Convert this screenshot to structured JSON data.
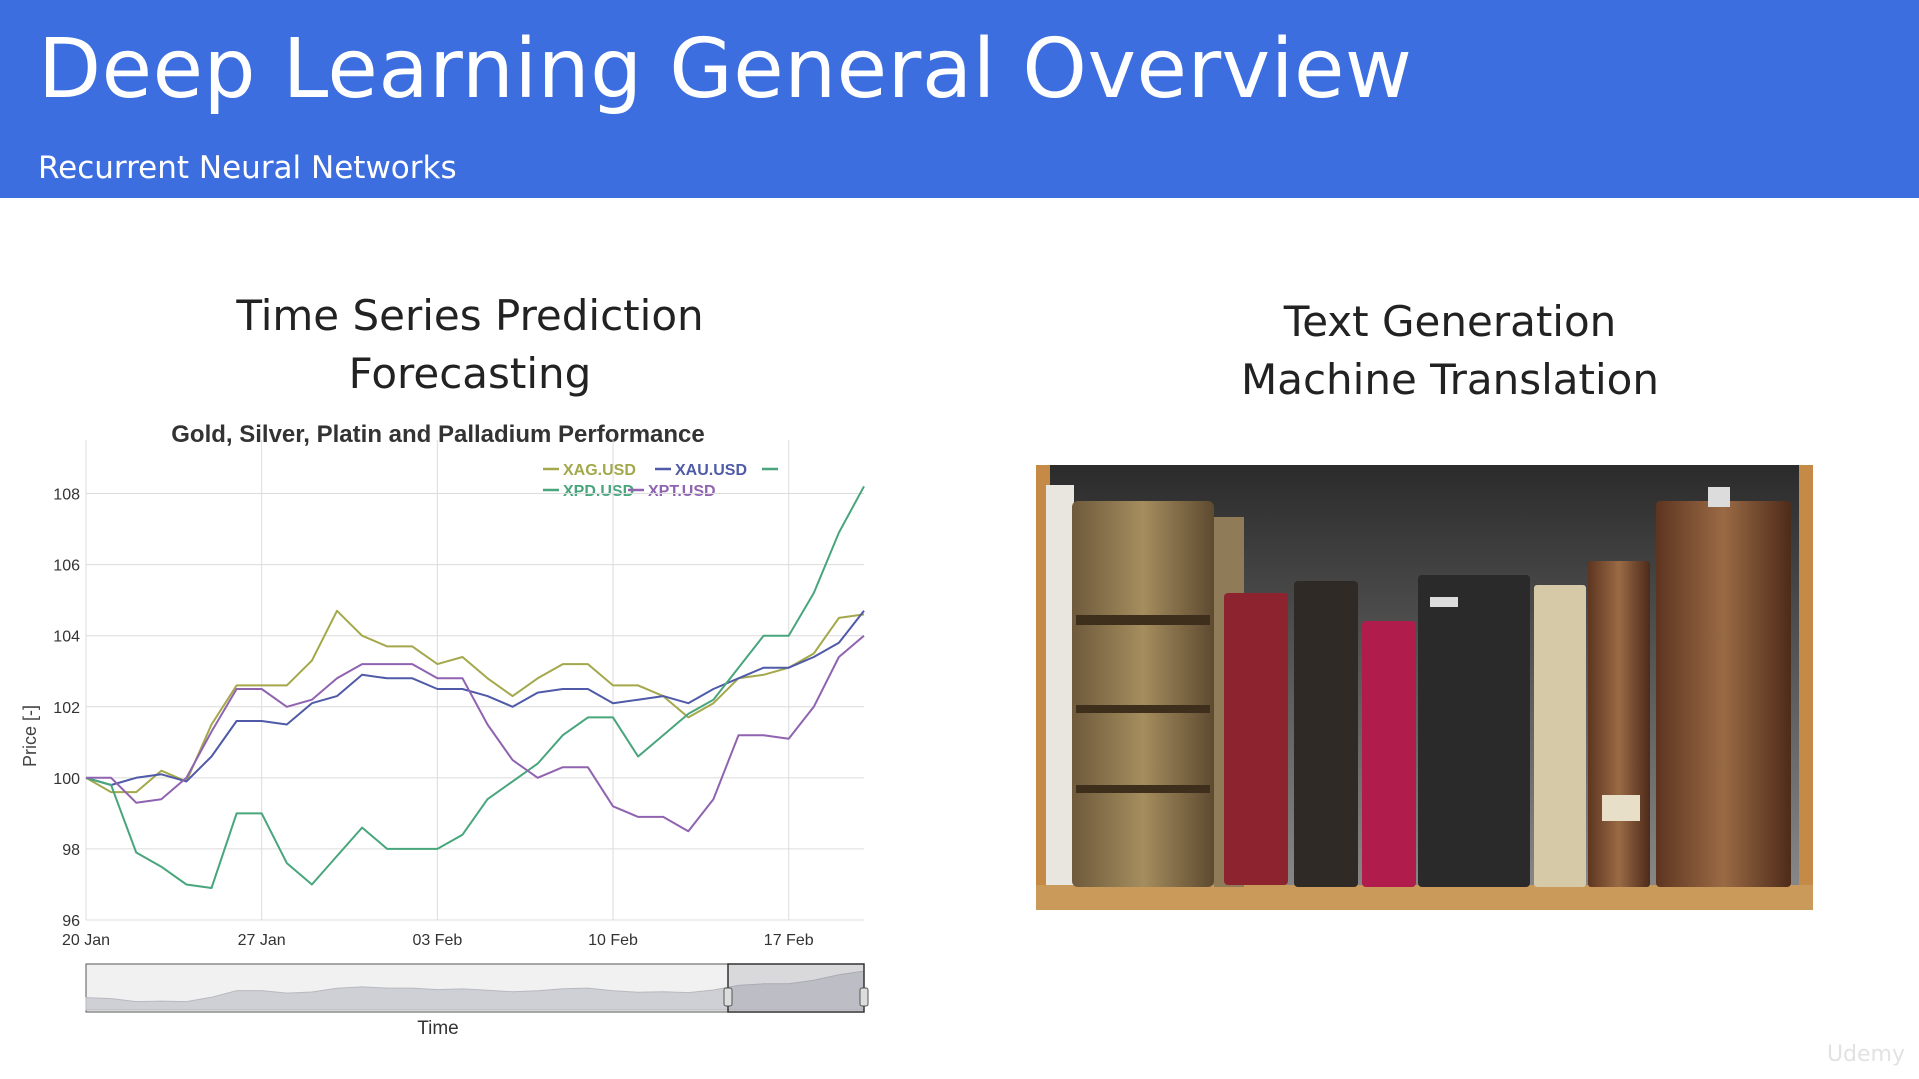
{
  "slide": {
    "title": "Deep Learning General Overview",
    "subtitle": "Recurrent Neural Networks",
    "left_heading": [
      "Time Series Prediction",
      "Forecasting"
    ],
    "right_heading": [
      "Text Generation",
      "Machine Translation"
    ],
    "watermark": "Udemy",
    "header_color": "#3c6ee0"
  },
  "chart_data": {
    "type": "line",
    "title": "Gold, Silver, Platin and Palladium Performance",
    "xlabel": "Time",
    "ylabel": "Price [-]",
    "x_ticks": [
      "20 Jan",
      "27 Jan",
      "03 Feb",
      "10 Feb",
      "17 Feb"
    ],
    "y_ticks": [
      96,
      98,
      100,
      102,
      104,
      106,
      108
    ],
    "ylim": [
      96,
      109
    ],
    "xlim_days": [
      0,
      31
    ],
    "grid": true,
    "legend_placement": "top-right",
    "range_selector": true,
    "series": [
      {
        "name": "XAG.USD",
        "color": "#a3a84a",
        "x": [
          0,
          1,
          2,
          3,
          4,
          5,
          6,
          7,
          8,
          9,
          10,
          11,
          12,
          13,
          14,
          15,
          16,
          17,
          18,
          19,
          20,
          21,
          22,
          23,
          24,
          25,
          26,
          27,
          28,
          29,
          30,
          31
        ],
        "values": [
          100,
          99.6,
          99.6,
          100.2,
          99.9,
          101.5,
          102.6,
          102.6,
          102.6,
          103.3,
          104.7,
          104.0,
          103.7,
          103.7,
          103.2,
          103.4,
          102.8,
          102.3,
          102.8,
          103.2,
          103.2,
          102.6,
          102.6,
          102.3,
          101.7,
          102.1,
          102.8,
          102.9,
          103.1,
          103.5,
          104.5,
          104.6
        ]
      },
      {
        "name": "XAU.USD",
        "color": "#4f5aa8",
        "x": [
          0,
          1,
          2,
          3,
          4,
          5,
          6,
          7,
          8,
          9,
          10,
          11,
          12,
          13,
          14,
          15,
          16,
          17,
          18,
          19,
          20,
          21,
          22,
          23,
          24,
          25,
          26,
          27,
          28,
          29,
          30,
          31
        ],
        "values": [
          100,
          99.8,
          100.0,
          100.1,
          99.9,
          100.6,
          101.6,
          101.6,
          101.5,
          102.1,
          102.3,
          102.9,
          102.8,
          102.8,
          102.5,
          102.5,
          102.3,
          102.0,
          102.4,
          102.5,
          102.5,
          102.1,
          102.2,
          102.3,
          102.1,
          102.5,
          102.8,
          103.1,
          103.1,
          103.4,
          103.8,
          104.7
        ]
      },
      {
        "name": "XPD.USD",
        "color": "#48a57c",
        "x": [
          0,
          1,
          2,
          3,
          4,
          5,
          6,
          7,
          8,
          9,
          10,
          11,
          12,
          13,
          14,
          15,
          16,
          17,
          18,
          19,
          20,
          21,
          22,
          23,
          24,
          25,
          26,
          27,
          28,
          29,
          30,
          31
        ],
        "values": [
          100,
          99.8,
          97.9,
          97.5,
          97.0,
          96.9,
          99.0,
          99.0,
          97.6,
          97.0,
          97.8,
          98.6,
          98.0,
          98.0,
          98.0,
          98.4,
          99.4,
          99.9,
          100.4,
          101.2,
          101.7,
          101.7,
          100.6,
          101.2,
          101.8,
          102.2,
          103.1,
          104.0,
          104.0,
          105.2,
          106.9,
          108.2
        ]
      },
      {
        "name": "XPT.USD",
        "color": "#9063b0",
        "x": [
          0,
          1,
          2,
          3,
          4,
          5,
          6,
          7,
          8,
          9,
          10,
          11,
          12,
          13,
          14,
          15,
          16,
          17,
          18,
          19,
          20,
          21,
          22,
          23,
          24,
          25,
          26,
          27,
          28,
          29,
          30,
          31
        ],
        "values": [
          100,
          100.0,
          99.3,
          99.4,
          100.0,
          101.3,
          102.5,
          102.5,
          102.0,
          102.2,
          102.8,
          103.2,
          103.2,
          103.2,
          102.8,
          102.8,
          101.5,
          100.5,
          100.0,
          100.3,
          100.3,
          99.2,
          98.9,
          98.9,
          98.5,
          99.4,
          101.2,
          101.2,
          101.1,
          102.0,
          103.4,
          104.0
        ]
      }
    ]
  }
}
